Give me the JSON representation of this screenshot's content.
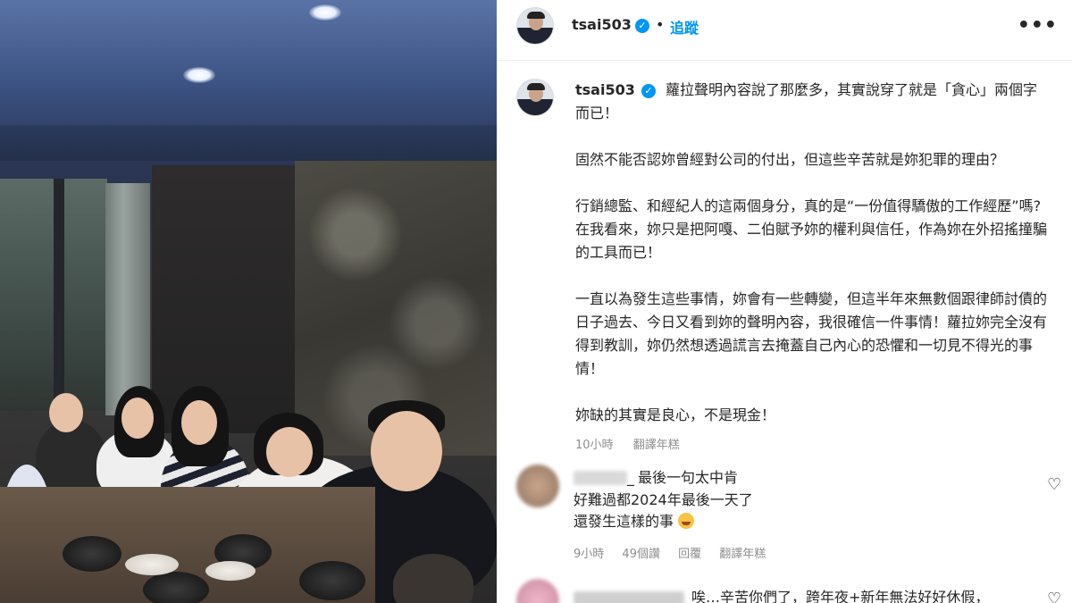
{
  "post": {
    "username": "tsai503",
    "dot": "•",
    "follow_label": "追蹤",
    "more_label": "•••",
    "caption": [
      "蘿拉聲明內容說了那麼多，其實說穿了就是「貪心」兩個字而已！",
      "固然不能否認妳曾經對公司的付出，但這些辛苦就是妳犯罪的理由？",
      "行銷總監、和經紀人的這兩個身分，真的是“一份值得驕傲的工作經歷”嗎?在我看來，妳只是把阿嘎、二伯賦予妳的權利與信任，作為妳在外招搖撞騙的工具而已！",
      "一直以為發生這些事情，妳會有一些轉變，但這半年來無數個跟律師討債的日子過去、今日又看到妳的聲明內容，我很確信一件事情！蘿拉妳完全沒有得到教訓，妳仍然想透過謊言去掩蓋自己內心的恐懼和一切見不得光的事情！",
      "妳缺的其實是良心，不是現金！"
    ],
    "time": "10小時",
    "translate_label": "翻譯年糕"
  },
  "comments": [
    {
      "username_suffix": "_",
      "line1": "最後一句太中肯",
      "line2": "好難過都2024年最後一天了",
      "line3": "還發生這樣的事",
      "time": "9小時",
      "likes": "49個讚",
      "reply_label": "回覆",
      "translate_label": "翻譯年糕",
      "heart_icon": "heart-outline-icon"
    },
    {
      "text": "唉…辛苦你們了，跨年夜+新年無法好好休假，",
      "heart_icon": "heart-outline-icon"
    }
  ],
  "colors": {
    "link_blue": "#0095f6",
    "meta_gray": "#8e8e8e",
    "text": "#262626"
  }
}
